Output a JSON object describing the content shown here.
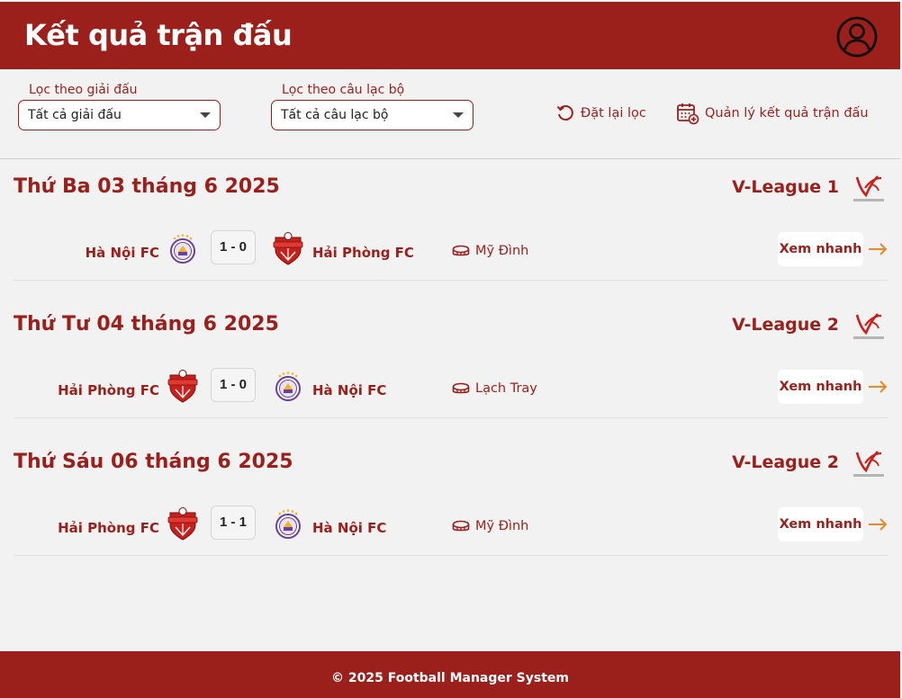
{
  "header": {
    "title": "Kết quả trận đấu",
    "avatar_icon": "user-circle-icon"
  },
  "filters": {
    "league": {
      "label": "Lọc theo giải đấu",
      "value": "Tất cả giải đấu"
    },
    "club": {
      "label": "Lọc theo câu lạc bộ",
      "value": "Tất cả câu lạc bộ"
    },
    "reset_label": "Đặt lại lọc",
    "manage_label": "Quản lý kết quả trận đấu"
  },
  "days": [
    {
      "title": "Thứ Ba 03 tháng 6 2025",
      "league": "V-League 1",
      "match": {
        "home": "Hà Nội FC",
        "home_logo": "hanoi",
        "score": "1 - 0",
        "away": "Hải Phòng FC",
        "away_logo": "haiphong",
        "venue": "Mỹ Đình",
        "quick": "Xem nhanh"
      }
    },
    {
      "title": "Thứ Tư 04 tháng 6 2025",
      "league": "V-League 2",
      "match": {
        "home": "Hải Phòng FC",
        "home_logo": "haiphong",
        "score": "1 - 0",
        "away": "Hà Nội FC",
        "away_logo": "hanoi",
        "venue": "Lạch Tray",
        "quick": "Xem nhanh"
      }
    },
    {
      "title": "Thứ Sáu 06 tháng 6 2025",
      "league": "V-League 2",
      "match": {
        "home": "Hải Phòng FC",
        "home_logo": "haiphong",
        "score": "1 - 1",
        "away": "Hà Nội FC",
        "away_logo": "hanoi",
        "venue": "Mỹ Đình",
        "quick": "Xem nhanh"
      }
    }
  ],
  "footer": {
    "text": "© 2025 Football Manager System"
  },
  "colors": {
    "brand": "#9b1f1b",
    "arrow": "#e8892b",
    "background": "#f3f2f2"
  }
}
